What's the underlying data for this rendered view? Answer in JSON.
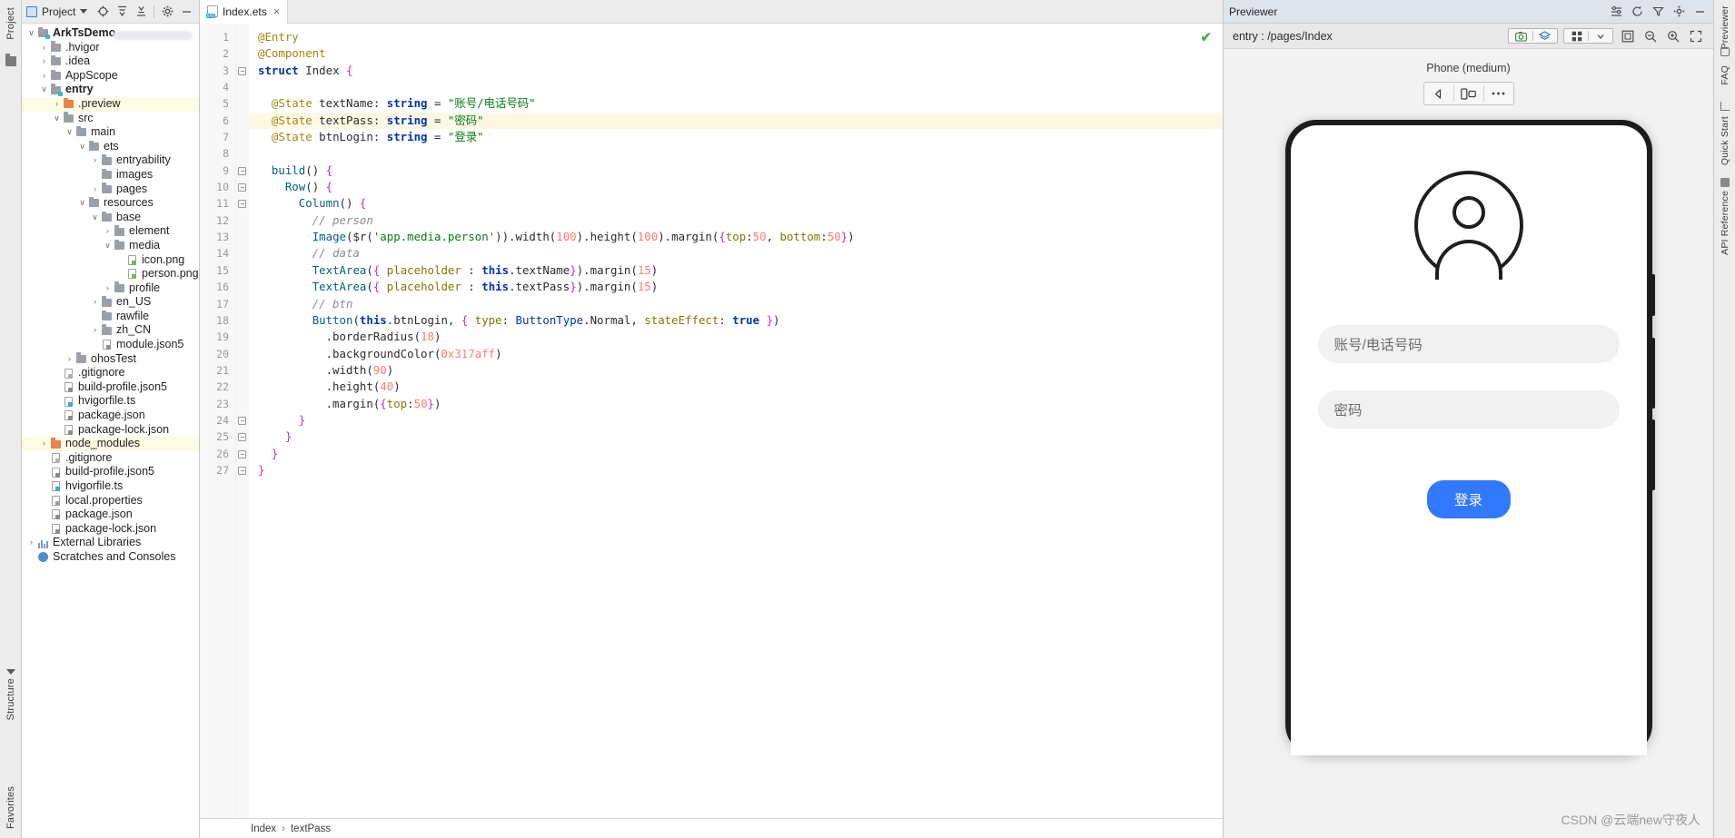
{
  "left_strip": {
    "project_label": "Project",
    "structure_label": "Structure",
    "favorites_label": "Favorites"
  },
  "project_panel": {
    "title": "Project",
    "icons": [
      "project-select-icon",
      "chevron-down-icon",
      "locate-icon",
      "expand-all-icon",
      "collapse-all-icon",
      "gear-icon",
      "minimize-icon"
    ],
    "tree": [
      {
        "label": "ArkTsDemo",
        "depth": 0,
        "arrow": "down",
        "icon": "folder-module",
        "bold": true,
        "highlight": false
      },
      {
        "label": ".hvigor",
        "depth": 1,
        "arrow": "right",
        "icon": "folder",
        "bold": false,
        "highlight": false
      },
      {
        "label": ".idea",
        "depth": 1,
        "arrow": "right",
        "icon": "folder",
        "bold": false,
        "highlight": false
      },
      {
        "label": "AppScope",
        "depth": 1,
        "arrow": "right",
        "icon": "folder",
        "bold": false,
        "highlight": false
      },
      {
        "label": "entry",
        "depth": 1,
        "arrow": "down",
        "icon": "folder-module",
        "bold": true,
        "highlight": false
      },
      {
        "label": ".preview",
        "depth": 2,
        "arrow": "right",
        "icon": "folder-orange",
        "bold": false,
        "highlight": true
      },
      {
        "label": "src",
        "depth": 2,
        "arrow": "down",
        "icon": "folder",
        "bold": false,
        "highlight": false
      },
      {
        "label": "main",
        "depth": 3,
        "arrow": "down",
        "icon": "folder",
        "bold": false,
        "highlight": false
      },
      {
        "label": "ets",
        "depth": 4,
        "arrow": "down",
        "icon": "folder",
        "bold": false,
        "highlight": false
      },
      {
        "label": "entryability",
        "depth": 5,
        "arrow": "right",
        "icon": "folder",
        "bold": false,
        "highlight": false
      },
      {
        "label": "images",
        "depth": 5,
        "arrow": "none",
        "icon": "folder",
        "bold": false,
        "highlight": false
      },
      {
        "label": "pages",
        "depth": 5,
        "arrow": "right",
        "icon": "folder",
        "bold": false,
        "highlight": false
      },
      {
        "label": "resources",
        "depth": 4,
        "arrow": "down",
        "icon": "folder",
        "bold": false,
        "highlight": false
      },
      {
        "label": "base",
        "depth": 5,
        "arrow": "down",
        "icon": "folder",
        "bold": false,
        "highlight": false
      },
      {
        "label": "element",
        "depth": 6,
        "arrow": "right",
        "icon": "folder",
        "bold": false,
        "highlight": false
      },
      {
        "label": "media",
        "depth": 6,
        "arrow": "down",
        "icon": "folder",
        "bold": false,
        "highlight": false
      },
      {
        "label": "icon.png",
        "depth": 7,
        "arrow": "none",
        "icon": "file-image",
        "bold": false,
        "highlight": false
      },
      {
        "label": "person.png",
        "depth": 7,
        "arrow": "none",
        "icon": "file-image",
        "bold": false,
        "highlight": false
      },
      {
        "label": "profile",
        "depth": 6,
        "arrow": "right",
        "icon": "folder",
        "bold": false,
        "highlight": false
      },
      {
        "label": "en_US",
        "depth": 5,
        "arrow": "right",
        "icon": "folder",
        "bold": false,
        "highlight": false
      },
      {
        "label": "rawfile",
        "depth": 5,
        "arrow": "none",
        "icon": "folder",
        "bold": false,
        "highlight": false
      },
      {
        "label": "zh_CN",
        "depth": 5,
        "arrow": "right",
        "icon": "folder",
        "bold": false,
        "highlight": false
      },
      {
        "label": "module.json5",
        "depth": 5,
        "arrow": "none",
        "icon": "file-json",
        "bold": false,
        "highlight": false
      },
      {
        "label": "ohosTest",
        "depth": 3,
        "arrow": "right",
        "icon": "folder",
        "bold": false,
        "highlight": false
      },
      {
        "label": ".gitignore",
        "depth": 2,
        "arrow": "none",
        "icon": "file-git",
        "bold": false,
        "highlight": false
      },
      {
        "label": "build-profile.json5",
        "depth": 2,
        "arrow": "none",
        "icon": "file-json",
        "bold": false,
        "highlight": false
      },
      {
        "label": "hvigorfile.ts",
        "depth": 2,
        "arrow": "none",
        "icon": "file-ts",
        "bold": false,
        "highlight": false
      },
      {
        "label": "package.json",
        "depth": 2,
        "arrow": "none",
        "icon": "file-json",
        "bold": false,
        "highlight": false
      },
      {
        "label": "package-lock.json",
        "depth": 2,
        "arrow": "none",
        "icon": "file-json",
        "bold": false,
        "highlight": false
      },
      {
        "label": "node_modules",
        "depth": 1,
        "arrow": "right",
        "icon": "folder-orange",
        "bold": false,
        "highlight": true
      },
      {
        "label": ".gitignore",
        "depth": 1,
        "arrow": "none",
        "icon": "file-git",
        "bold": false,
        "highlight": false
      },
      {
        "label": "build-profile.json5",
        "depth": 1,
        "arrow": "none",
        "icon": "file-json",
        "bold": false,
        "highlight": false
      },
      {
        "label": "hvigorfile.ts",
        "depth": 1,
        "arrow": "none",
        "icon": "file-ts",
        "bold": false,
        "highlight": false
      },
      {
        "label": "local.properties",
        "depth": 1,
        "arrow": "none",
        "icon": "file-props",
        "bold": false,
        "highlight": false
      },
      {
        "label": "package.json",
        "depth": 1,
        "arrow": "none",
        "icon": "file-json",
        "bold": false,
        "highlight": false
      },
      {
        "label": "package-lock.json",
        "depth": 1,
        "arrow": "none",
        "icon": "file-json",
        "bold": false,
        "highlight": false
      },
      {
        "label": "External Libraries",
        "depth": 0,
        "arrow": "right",
        "icon": "library",
        "bold": false,
        "highlight": false
      },
      {
        "label": "Scratches and Consoles",
        "depth": 0,
        "arrow": "none",
        "icon": "console",
        "bold": false,
        "highlight": false
      }
    ]
  },
  "editor": {
    "tab": {
      "label": "Index.ets",
      "icon": "ets-file-icon",
      "close": "×"
    },
    "status_icon": "check-ok-icon",
    "line_count": 27,
    "highlight_line": 6,
    "fold_lines": [
      3,
      9,
      10,
      11,
      24,
      25,
      26,
      27
    ],
    "lines": [
      {
        "n": 1,
        "text": "@Entry"
      },
      {
        "n": 2,
        "text": "@Component"
      },
      {
        "n": 3,
        "text": "struct Index {"
      },
      {
        "n": 4,
        "text": ""
      },
      {
        "n": 5,
        "text": "  @State textName: string = \"账号/电话号码\""
      },
      {
        "n": 6,
        "text": "  @State textPass: string = \"密码\""
      },
      {
        "n": 7,
        "text": "  @State btnLogin: string = \"登录\""
      },
      {
        "n": 8,
        "text": ""
      },
      {
        "n": 9,
        "text": "  build() {"
      },
      {
        "n": 10,
        "text": "    Row() {"
      },
      {
        "n": 11,
        "text": "      Column() {"
      },
      {
        "n": 12,
        "text": "        // person"
      },
      {
        "n": 13,
        "text": "        Image($r('app.media.person')).width(100).height(100).margin({top:50, bottom:50})"
      },
      {
        "n": 14,
        "text": "        // data"
      },
      {
        "n": 15,
        "text": "        TextArea({ placeholder : this.textName}).margin(15)"
      },
      {
        "n": 16,
        "text": "        TextArea({ placeholder : this.textPass}).margin(15)"
      },
      {
        "n": 17,
        "text": "        // btn"
      },
      {
        "n": 18,
        "text": "        Button(this.btnLogin, { type: ButtonType.Normal, stateEffect: true })"
      },
      {
        "n": 19,
        "text": "          .borderRadius(18)"
      },
      {
        "n": 20,
        "text": "          .backgroundColor(0x317aff)"
      },
      {
        "n": 21,
        "text": "          .width(90)"
      },
      {
        "n": 22,
        "text": "          .height(40)"
      },
      {
        "n": 23,
        "text": "          .margin({top:50})"
      },
      {
        "n": 24,
        "text": "      }"
      },
      {
        "n": 25,
        "text": "    }"
      },
      {
        "n": 26,
        "text": "  }"
      },
      {
        "n": 27,
        "text": "}"
      }
    ],
    "breadcrumb": {
      "first": "Index",
      "sep": "›",
      "second": "textPass"
    }
  },
  "previewer": {
    "title": "Previewer",
    "toolbar_icons": [
      "settings-sliders-icon",
      "refresh-icon",
      "filter-icon",
      "gear-icon",
      "minimize-icon"
    ],
    "path": "entry : /pages/Index",
    "sub_icons": [
      "screenshot-icon",
      "layers-icon",
      "grid-icon",
      "chevron-down-icon",
      "fit-icon",
      "zoom-out-icon",
      "zoom-in-icon",
      "expand-icon"
    ],
    "device": "Phone (medium)",
    "controls": [
      "rotate-icon",
      "multi-device-icon",
      "more-icon"
    ],
    "phone_preview": {
      "avatar_icon": "person-avatar-icon",
      "field_account": "账号/电话号码",
      "field_password": "密码",
      "login_button": "登录",
      "login_button_color": "#317aff"
    },
    "watermark": "CSDN @云端new守夜人"
  },
  "right_strip": {
    "items": [
      "Previewer",
      "FAQ",
      "Quick Start",
      "API Reference"
    ]
  }
}
